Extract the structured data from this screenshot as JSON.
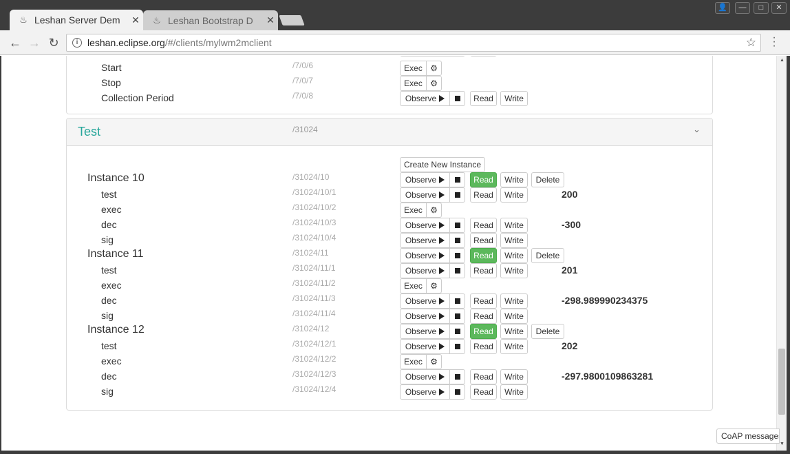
{
  "browser": {
    "tabs": [
      {
        "title": "Leshan Server Dem",
        "close": "✕"
      },
      {
        "title": "Leshan Bootstrap D",
        "close": "✕"
      }
    ],
    "url_host": "leshan.eclipse.org",
    "url_path": "/#/clients/mylwm2mclient"
  },
  "buttons": {
    "exec": "Exec",
    "observe": "Observe",
    "read": "Read",
    "write": "Write",
    "delete": "Delete",
    "create_instance": "Create New Instance",
    "coap": "CoAP messages"
  },
  "object7": {
    "resources": [
      {
        "name": "Start",
        "path": "/7/0/6"
      },
      {
        "name": "Stop",
        "path": "/7/0/7"
      },
      {
        "name": "Collection Period",
        "path": "/7/0/8"
      }
    ]
  },
  "test_object": {
    "title": "Test",
    "path": "/31024",
    "instances": [
      {
        "name": "Instance 10",
        "path": "/31024/10",
        "resources": [
          {
            "name": "test",
            "path": "/31024/10/1",
            "value": "200"
          },
          {
            "name": "exec",
            "path": "/31024/10/2"
          },
          {
            "name": "dec",
            "path": "/31024/10/3",
            "value": "-300"
          },
          {
            "name": "sig",
            "path": "/31024/10/4"
          }
        ]
      },
      {
        "name": "Instance 11",
        "path": "/31024/11",
        "resources": [
          {
            "name": "test",
            "path": "/31024/11/1",
            "value": "201"
          },
          {
            "name": "exec",
            "path": "/31024/11/2"
          },
          {
            "name": "dec",
            "path": "/31024/11/3",
            "value": "-298.989990234375"
          },
          {
            "name": "sig",
            "path": "/31024/11/4"
          }
        ]
      },
      {
        "name": "Instance 12",
        "path": "/31024/12",
        "resources": [
          {
            "name": "test",
            "path": "/31024/12/1",
            "value": "202"
          },
          {
            "name": "exec",
            "path": "/31024/12/2"
          },
          {
            "name": "dec",
            "path": "/31024/12/3",
            "value": "-297.9800109863281"
          },
          {
            "name": "sig",
            "path": "/31024/12/4"
          }
        ]
      }
    ]
  },
  "colors": {
    "title_teal": "#26a69a",
    "read_green": "#5cb85c"
  }
}
